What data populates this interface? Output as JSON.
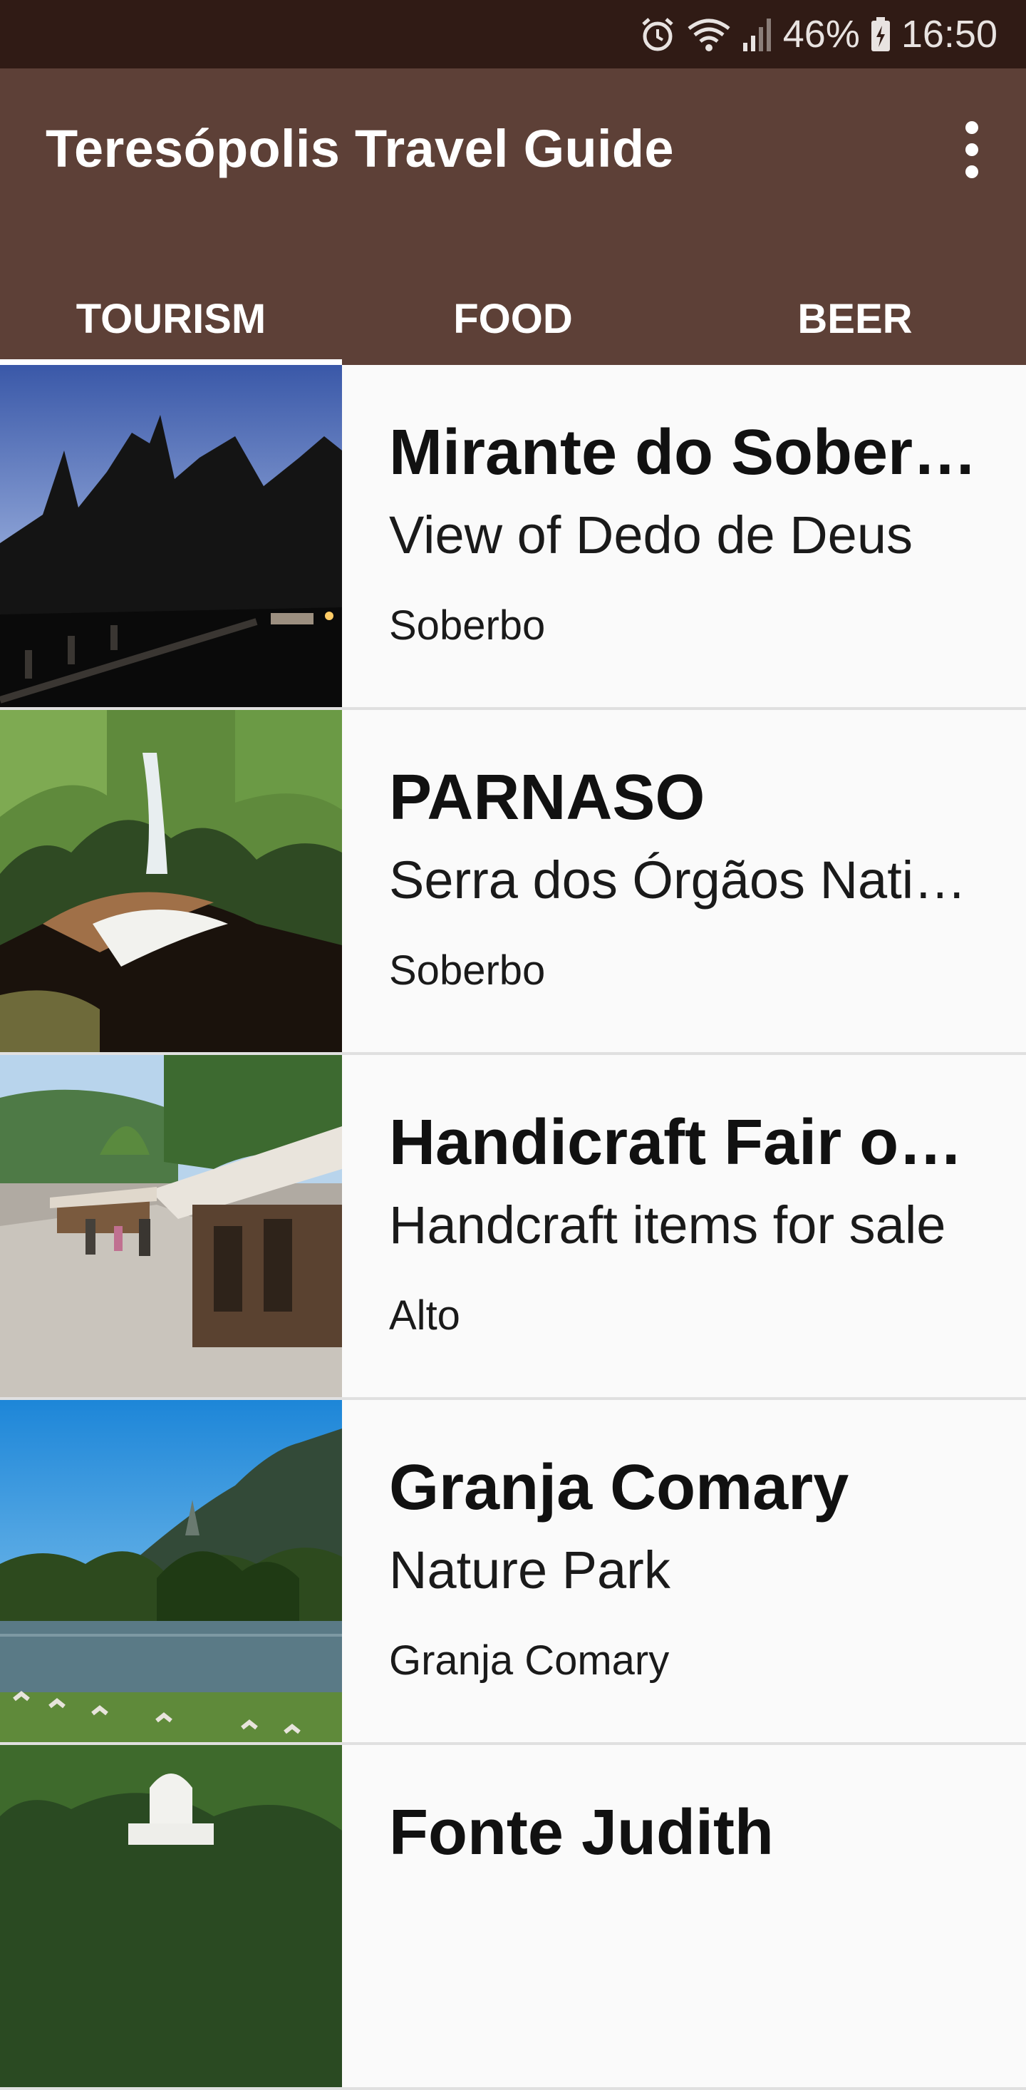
{
  "status_bar": {
    "battery": "46%",
    "time": "16:50",
    "icons": [
      "alarm-icon",
      "wifi-icon",
      "signal-icon",
      "battery-icon"
    ]
  },
  "app_bar": {
    "title": "Teresópolis Travel Guide",
    "menu_icon": "more-vert-icon",
    "tabs": [
      {
        "label": "TOURISM",
        "active": true
      },
      {
        "label": "FOOD",
        "active": false
      },
      {
        "label": "BEER",
        "active": false
      }
    ]
  },
  "items": [
    {
      "title": "Mirante do Soberbo",
      "subtitle": "View of Dedo de Deus",
      "location": "Soberbo",
      "image": "mountain-silhouette-photo"
    },
    {
      "title": "PARNASO",
      "subtitle": "Serra dos Órgãos National Park",
      "location": "Soberbo",
      "image": "waterfall-photo"
    },
    {
      "title": "Handicraft Fair of Alto",
      "subtitle": "Handcraft items for sale",
      "location": "Alto",
      "image": "street-fair-photo"
    },
    {
      "title": "Granja Comary",
      "subtitle": "Nature Park",
      "location": "Granja Comary",
      "image": "lake-park-photo"
    },
    {
      "title": "Fonte Judith",
      "subtitle": "",
      "location": "",
      "image": "fountain-photo"
    }
  ],
  "colors": {
    "primary": "#5d4037",
    "status_bar": "#301b15",
    "background": "#fafafa",
    "divider": "#e0e0e0"
  }
}
